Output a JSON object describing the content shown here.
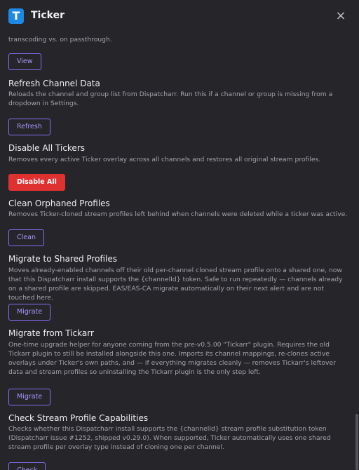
{
  "header": {
    "title": "Ticker",
    "logo_letter": "T",
    "close_icon": "×"
  },
  "sections": {
    "top_partial": {
      "desc": "transcoding vs. on passthrough.",
      "button": "View"
    },
    "refresh": {
      "title": "Refresh Channel Data",
      "desc": "Reloads the channel and group list from Dispatcharr. Run this if a channel or group is missing from a dropdown in Settings.",
      "button": "Refresh"
    },
    "disable": {
      "title": "Disable All Tickers",
      "desc": "Removes every active Ticker overlay across all channels and restores all original stream profiles.",
      "button": "Disable All"
    },
    "clean": {
      "title": "Clean Orphaned Profiles",
      "desc": "Removes Ticker-cloned stream profiles left behind when channels were deleted while a ticker was active.",
      "button": "Clean"
    },
    "migrate_shared": {
      "title": "Migrate to Shared Profiles",
      "desc": "Moves already-enabled channels off their old per-channel cloned stream profile onto a shared one, now that this Dispatcharr install supports the {channelId} token. Safe to run repeatedly — channels already on a shared profile are skipped. EAS/EAS-CA migrate automatically on their next alert and are not touched here.",
      "button": "Migrate"
    },
    "migrate_tickarr": {
      "title": "Migrate from Tickarr",
      "desc": "One-time upgrade helper for anyone coming from the pre-v0.5.00 \"Tickarr\" plugin. Requires the old Tickarr plugin to still be installed alongside this one. Imports its channel mappings, re-clones active overlays under Ticker's own paths, and — if everything migrates cleanly — removes Tickarr's leftover data and stream profiles so uninstalling the Tickarr plugin is the only step left.",
      "button": "Migrate"
    },
    "check_caps": {
      "title": "Check Stream Profile Capabilities",
      "desc": "Checks whether this Dispatcharr install supports the {channelId} stream profile substitution token (Dispatcharr issue #1252, shipped v0.29.0). When supported, Ticker automatically uses one shared stream profile per overlay type instead of cloning one per channel.",
      "button": "Check"
    }
  }
}
